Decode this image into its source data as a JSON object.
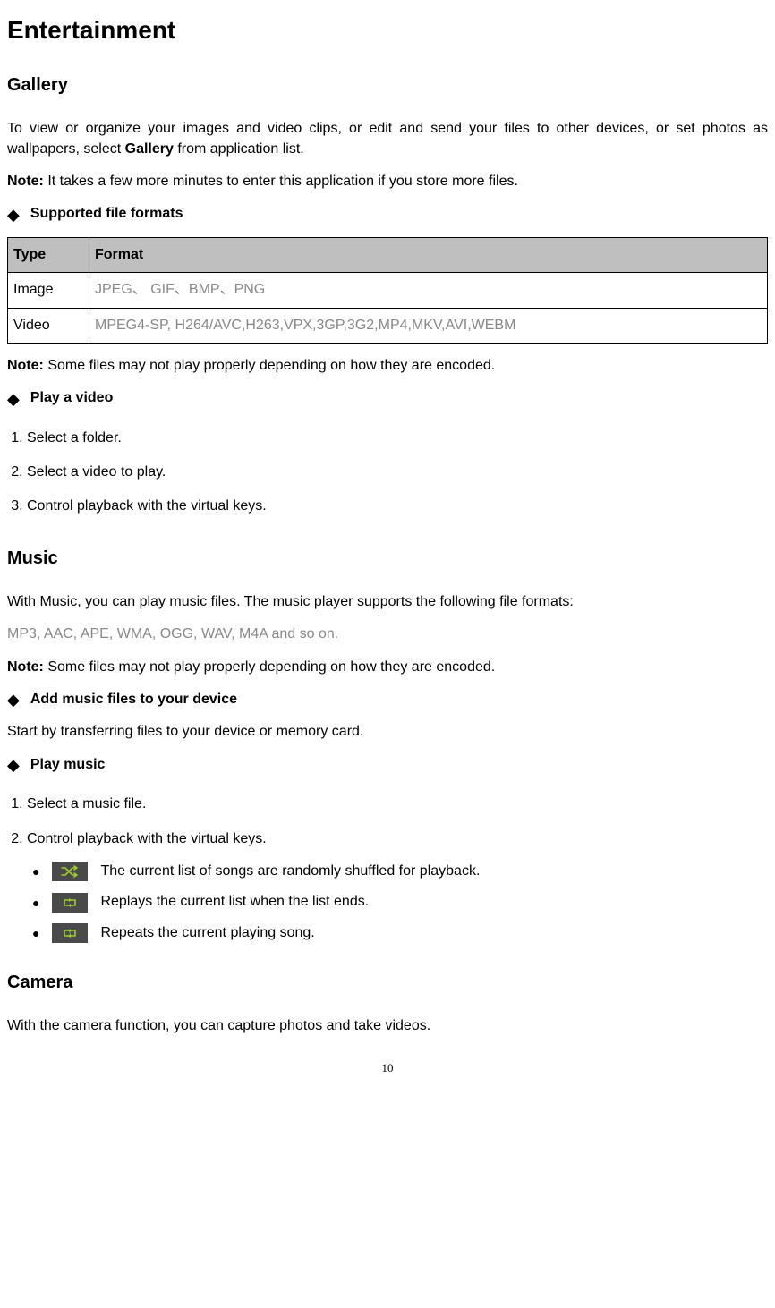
{
  "h1": "Entertainment",
  "gallery": {
    "heading": "Gallery",
    "intro_pre": "To view or organize your images and video clips, or edit and send your files to other devices, or set photos as wallpapers, select ",
    "intro_bold": "Gallery",
    "intro_post": " from application list.",
    "note1_label": "Note:",
    "note1_text": " It takes a few more minutes to enter this application if you store more files.",
    "supported_formats": "Supported file formats",
    "table": {
      "h_type": "Type",
      "h_format": "Format",
      "r1_type": "Image",
      "r1_format": "JPEG、 GIF、BMP、PNG",
      "r2_type": "Video",
      "r2_format": "MPEG4-SP, H264/AVC,H263,VPX,3GP,3G2,MP4,MKV,AVI,WEBM"
    },
    "note2_label": "Note:",
    "note2_text": " Some files may not play properly depending on how they are encoded.",
    "play_video": "Play a video",
    "steps": {
      "s1": "Select a folder.",
      "s2": "Select a video to play.",
      "s3": "Control playback with the virtual keys."
    }
  },
  "music": {
    "heading": "Music",
    "intro": "With Music, you can play music files. The music player supports the following file formats:",
    "formats": "MP3, AAC, APE, WMA, OGG, WAV, M4A and so on.",
    "note_label": "Note:",
    "note_text": " Some files may not play properly depending on how they are encoded.",
    "add_files": "Add music files to your device",
    "add_files_text": "Start by transferring files to your device or memory card.",
    "play_music": "Play music",
    "steps": {
      "s1": "Select a music file.",
      "s2": "Control playback with the virtual keys."
    },
    "icons": {
      "shuffle": "The current list of songs are randomly shuffled for playback.",
      "repeat_list": "Replays the current list when the list ends.",
      "repeat_one": "Repeats the current playing song."
    }
  },
  "camera": {
    "heading": "Camera",
    "intro": "With the camera function, you can capture photos and take videos."
  },
  "page_number": "10"
}
